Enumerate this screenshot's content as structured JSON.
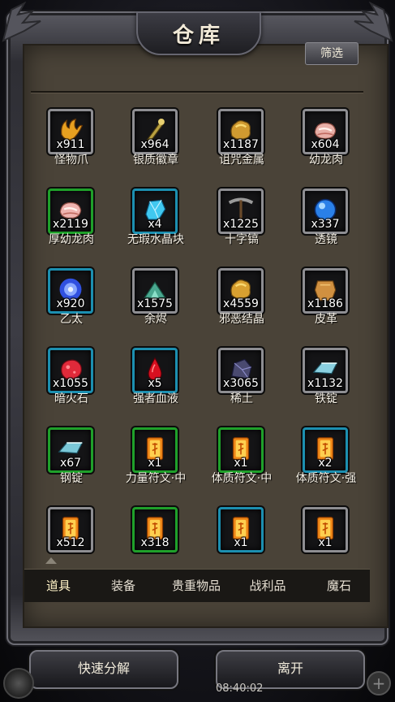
{
  "window": {
    "title": "仓库",
    "filter_label": "筛选"
  },
  "items": [
    {
      "qty": "x911",
      "name": "怪物爪",
      "border": "gray",
      "icon": "claw-icon",
      "color": "#e8a020"
    },
    {
      "qty": "x964",
      "name": "银质徽章",
      "border": "gray",
      "icon": "badge-icon",
      "color": "#b8a040"
    },
    {
      "qty": "x1187",
      "name": "诅咒金属",
      "border": "gray",
      "icon": "metal-icon",
      "color": "#d09a30"
    },
    {
      "qty": "x604",
      "name": "幼龙肉",
      "border": "gray",
      "icon": "meat-icon",
      "color": "#e8b0a8"
    },
    {
      "qty": "x2119",
      "name": "厚幼龙肉",
      "border": "green",
      "icon": "meat-icon",
      "color": "#f0b4b0"
    },
    {
      "qty": "x4",
      "name": "无瑕水晶块",
      "border": "blue",
      "icon": "crystal-icon",
      "color": "#40c8f0"
    },
    {
      "qty": "x1225",
      "name": "十字镐",
      "border": "gray",
      "icon": "pickaxe-icon",
      "color": "#9a9a9a"
    },
    {
      "qty": "x337",
      "name": "透镜",
      "border": "gray",
      "icon": "lens-icon",
      "color": "#2a80e8"
    },
    {
      "qty": "x920",
      "name": "乙太",
      "border": "blue",
      "icon": "ether-icon",
      "color": "#3050e0"
    },
    {
      "qty": "x1575",
      "name": "余烬",
      "border": "gray",
      "icon": "ember-icon",
      "color": "#4aa890"
    },
    {
      "qty": "x4559",
      "name": "邪恶结晶",
      "border": "gray",
      "icon": "metal-icon",
      "color": "#d8a030"
    },
    {
      "qty": "x1186",
      "name": "皮革",
      "border": "gray",
      "icon": "leather-icon",
      "color": "#d09040"
    },
    {
      "qty": "x1055",
      "name": "暗火石",
      "border": "blue",
      "icon": "firestone-icon",
      "color": "#e02a3a"
    },
    {
      "qty": "x5",
      "name": "强者血液",
      "border": "blue",
      "icon": "blood-drop-icon",
      "color": "#d81020"
    },
    {
      "qty": "x3065",
      "name": "稀土",
      "border": "gray",
      "icon": "rare-earth-icon",
      "color": "#4a4a70"
    },
    {
      "qty": "x1132",
      "name": "铁锭",
      "border": "gray",
      "icon": "ingot-icon",
      "color": "#8ad0e0"
    },
    {
      "qty": "x67",
      "name": "钢锭",
      "border": "green",
      "icon": "ingot-icon",
      "color": "#7ac8d8"
    },
    {
      "qty": "x1",
      "name": "力量符文·中",
      "border": "green",
      "icon": "rune-icon",
      "color": "#f08818"
    },
    {
      "qty": "x1",
      "name": "体质符文·中",
      "border": "green",
      "icon": "rune-icon",
      "color": "#f08818"
    },
    {
      "qty": "x2",
      "name": "体质符文·强",
      "border": "blue",
      "icon": "rune-icon",
      "color": "#f08818"
    },
    {
      "qty": "x512",
      "name": "",
      "border": "gray",
      "icon": "rune-icon",
      "color": "#f08818"
    },
    {
      "qty": "x318",
      "name": "",
      "border": "green",
      "icon": "rune-icon",
      "color": "#f08818"
    },
    {
      "qty": "x1",
      "name": "",
      "border": "blue",
      "icon": "rune-icon",
      "color": "#f08818"
    },
    {
      "qty": "x1",
      "name": "",
      "border": "gray",
      "icon": "rune-icon",
      "color": "#f08818"
    }
  ],
  "tabs": [
    {
      "label": "道具",
      "active": true
    },
    {
      "label": "装备",
      "active": false
    },
    {
      "label": "贵重物品",
      "active": false
    },
    {
      "label": "战利品",
      "active": false
    },
    {
      "label": "魔石",
      "active": false
    }
  ],
  "actions": {
    "quick_salvage": "快速分解",
    "leave": "离开"
  },
  "status": {
    "time": "08:40:02"
  }
}
